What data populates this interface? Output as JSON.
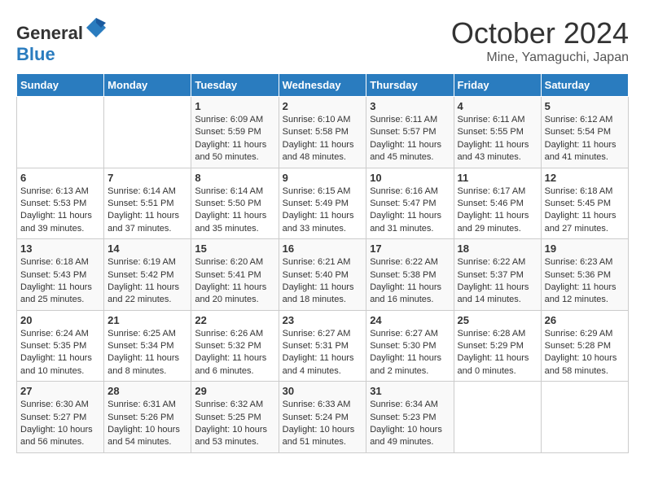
{
  "header": {
    "logo_general": "General",
    "logo_blue": "Blue",
    "month": "October 2024",
    "location": "Mine, Yamaguchi, Japan"
  },
  "weekdays": [
    "Sunday",
    "Monday",
    "Tuesday",
    "Wednesday",
    "Thursday",
    "Friday",
    "Saturday"
  ],
  "weeks": [
    [
      {
        "day": "",
        "sunrise": "",
        "sunset": "",
        "daylight": ""
      },
      {
        "day": "",
        "sunrise": "",
        "sunset": "",
        "daylight": ""
      },
      {
        "day": "1",
        "sunrise": "Sunrise: 6:09 AM",
        "sunset": "Sunset: 5:59 PM",
        "daylight": "Daylight: 11 hours and 50 minutes."
      },
      {
        "day": "2",
        "sunrise": "Sunrise: 6:10 AM",
        "sunset": "Sunset: 5:58 PM",
        "daylight": "Daylight: 11 hours and 48 minutes."
      },
      {
        "day": "3",
        "sunrise": "Sunrise: 6:11 AM",
        "sunset": "Sunset: 5:57 PM",
        "daylight": "Daylight: 11 hours and 45 minutes."
      },
      {
        "day": "4",
        "sunrise": "Sunrise: 6:11 AM",
        "sunset": "Sunset: 5:55 PM",
        "daylight": "Daylight: 11 hours and 43 minutes."
      },
      {
        "day": "5",
        "sunrise": "Sunrise: 6:12 AM",
        "sunset": "Sunset: 5:54 PM",
        "daylight": "Daylight: 11 hours and 41 minutes."
      }
    ],
    [
      {
        "day": "6",
        "sunrise": "Sunrise: 6:13 AM",
        "sunset": "Sunset: 5:53 PM",
        "daylight": "Daylight: 11 hours and 39 minutes."
      },
      {
        "day": "7",
        "sunrise": "Sunrise: 6:14 AM",
        "sunset": "Sunset: 5:51 PM",
        "daylight": "Daylight: 11 hours and 37 minutes."
      },
      {
        "day": "8",
        "sunrise": "Sunrise: 6:14 AM",
        "sunset": "Sunset: 5:50 PM",
        "daylight": "Daylight: 11 hours and 35 minutes."
      },
      {
        "day": "9",
        "sunrise": "Sunrise: 6:15 AM",
        "sunset": "Sunset: 5:49 PM",
        "daylight": "Daylight: 11 hours and 33 minutes."
      },
      {
        "day": "10",
        "sunrise": "Sunrise: 6:16 AM",
        "sunset": "Sunset: 5:47 PM",
        "daylight": "Daylight: 11 hours and 31 minutes."
      },
      {
        "day": "11",
        "sunrise": "Sunrise: 6:17 AM",
        "sunset": "Sunset: 5:46 PM",
        "daylight": "Daylight: 11 hours and 29 minutes."
      },
      {
        "day": "12",
        "sunrise": "Sunrise: 6:18 AM",
        "sunset": "Sunset: 5:45 PM",
        "daylight": "Daylight: 11 hours and 27 minutes."
      }
    ],
    [
      {
        "day": "13",
        "sunrise": "Sunrise: 6:18 AM",
        "sunset": "Sunset: 5:43 PM",
        "daylight": "Daylight: 11 hours and 25 minutes."
      },
      {
        "day": "14",
        "sunrise": "Sunrise: 6:19 AM",
        "sunset": "Sunset: 5:42 PM",
        "daylight": "Daylight: 11 hours and 22 minutes."
      },
      {
        "day": "15",
        "sunrise": "Sunrise: 6:20 AM",
        "sunset": "Sunset: 5:41 PM",
        "daylight": "Daylight: 11 hours and 20 minutes."
      },
      {
        "day": "16",
        "sunrise": "Sunrise: 6:21 AM",
        "sunset": "Sunset: 5:40 PM",
        "daylight": "Daylight: 11 hours and 18 minutes."
      },
      {
        "day": "17",
        "sunrise": "Sunrise: 6:22 AM",
        "sunset": "Sunset: 5:38 PM",
        "daylight": "Daylight: 11 hours and 16 minutes."
      },
      {
        "day": "18",
        "sunrise": "Sunrise: 6:22 AM",
        "sunset": "Sunset: 5:37 PM",
        "daylight": "Daylight: 11 hours and 14 minutes."
      },
      {
        "day": "19",
        "sunrise": "Sunrise: 6:23 AM",
        "sunset": "Sunset: 5:36 PM",
        "daylight": "Daylight: 11 hours and 12 minutes."
      }
    ],
    [
      {
        "day": "20",
        "sunrise": "Sunrise: 6:24 AM",
        "sunset": "Sunset: 5:35 PM",
        "daylight": "Daylight: 11 hours and 10 minutes."
      },
      {
        "day": "21",
        "sunrise": "Sunrise: 6:25 AM",
        "sunset": "Sunset: 5:34 PM",
        "daylight": "Daylight: 11 hours and 8 minutes."
      },
      {
        "day": "22",
        "sunrise": "Sunrise: 6:26 AM",
        "sunset": "Sunset: 5:32 PM",
        "daylight": "Daylight: 11 hours and 6 minutes."
      },
      {
        "day": "23",
        "sunrise": "Sunrise: 6:27 AM",
        "sunset": "Sunset: 5:31 PM",
        "daylight": "Daylight: 11 hours and 4 minutes."
      },
      {
        "day": "24",
        "sunrise": "Sunrise: 6:27 AM",
        "sunset": "Sunset: 5:30 PM",
        "daylight": "Daylight: 11 hours and 2 minutes."
      },
      {
        "day": "25",
        "sunrise": "Sunrise: 6:28 AM",
        "sunset": "Sunset: 5:29 PM",
        "daylight": "Daylight: 11 hours and 0 minutes."
      },
      {
        "day": "26",
        "sunrise": "Sunrise: 6:29 AM",
        "sunset": "Sunset: 5:28 PM",
        "daylight": "Daylight: 10 hours and 58 minutes."
      }
    ],
    [
      {
        "day": "27",
        "sunrise": "Sunrise: 6:30 AM",
        "sunset": "Sunset: 5:27 PM",
        "daylight": "Daylight: 10 hours and 56 minutes."
      },
      {
        "day": "28",
        "sunrise": "Sunrise: 6:31 AM",
        "sunset": "Sunset: 5:26 PM",
        "daylight": "Daylight: 10 hours and 54 minutes."
      },
      {
        "day": "29",
        "sunrise": "Sunrise: 6:32 AM",
        "sunset": "Sunset: 5:25 PM",
        "daylight": "Daylight: 10 hours and 53 minutes."
      },
      {
        "day": "30",
        "sunrise": "Sunrise: 6:33 AM",
        "sunset": "Sunset: 5:24 PM",
        "daylight": "Daylight: 10 hours and 51 minutes."
      },
      {
        "day": "31",
        "sunrise": "Sunrise: 6:34 AM",
        "sunset": "Sunset: 5:23 PM",
        "daylight": "Daylight: 10 hours and 49 minutes."
      },
      {
        "day": "",
        "sunrise": "",
        "sunset": "",
        "daylight": ""
      },
      {
        "day": "",
        "sunrise": "",
        "sunset": "",
        "daylight": ""
      }
    ]
  ]
}
